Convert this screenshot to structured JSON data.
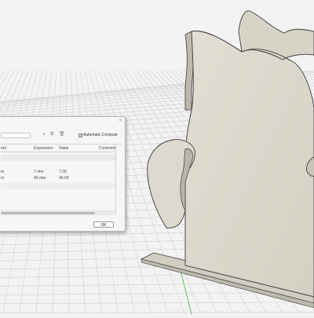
{
  "parameters_dialog": {
    "close_glyph": "×",
    "search": {
      "value": "",
      "placeholder": ""
    },
    "toolbar": {
      "add_icon": "plus-icon",
      "add_glyph": "+",
      "copy_icon": "copy-icon",
      "copy_glyph": "⧉",
      "delete_icon": "trash-icon",
      "delete_glyph": "🗑",
      "auto_compute_label": "Automatic Compute",
      "auto_compute_checked": true,
      "check_glyph": "✓"
    },
    "columns": [
      "ent",
      "Expression",
      "Value",
      "Comment"
    ],
    "rows": [
      {
        "name": "m",
        "expression": "7 mm",
        "value": "7.00"
      },
      {
        "name": "m",
        "expression": "40 mm",
        "value": "40.00"
      }
    ],
    "ok_label": "OK"
  },
  "colors": {
    "canvas_background": "#f3f3f3",
    "grid_line": "#cfcfcf",
    "model_face": "#d9d5c9",
    "model_edge": "#3c3c3c",
    "axis_red": "#e56060",
    "axis_green": "#5fbf5f"
  }
}
